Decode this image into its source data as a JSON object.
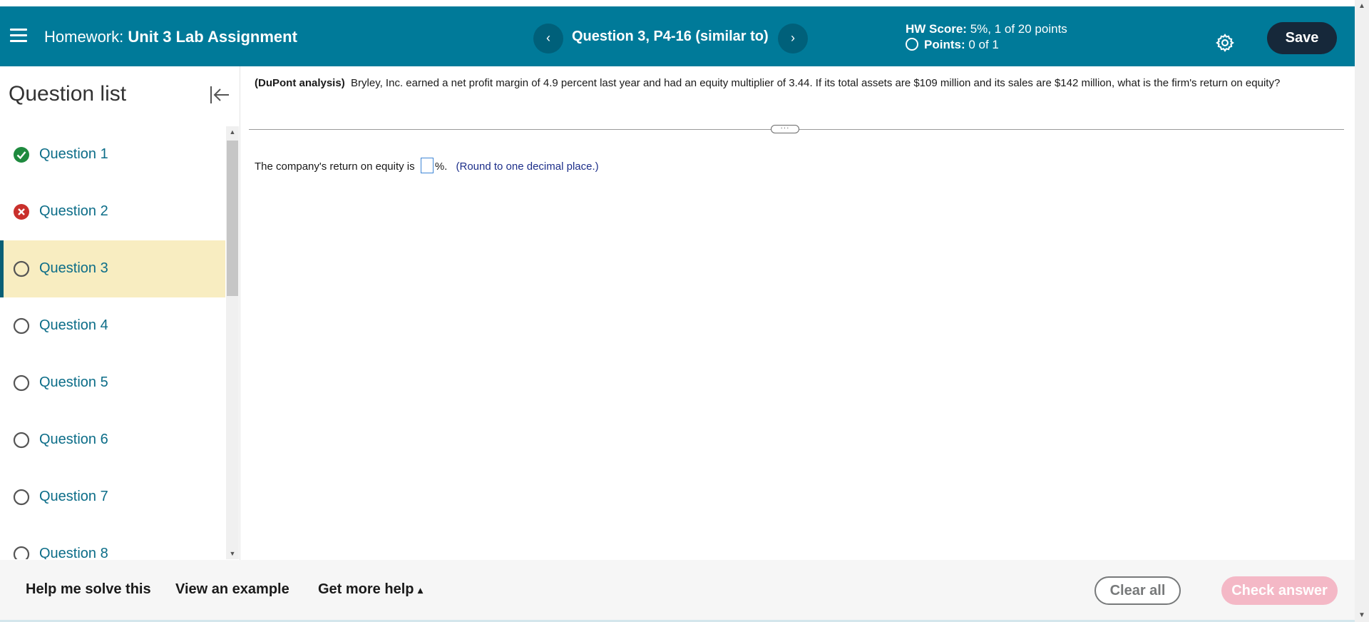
{
  "header": {
    "prefix": "Homework:",
    "assignment": "Unit 3 Lab Assignment",
    "question_title": "Question 3, P4-16 (similar to)",
    "hw_score_label": "HW Score:",
    "hw_score_value": "5%, 1 of 20 points",
    "points_label": "Points:",
    "points_value": "0 of 1",
    "save_label": "Save",
    "prev_glyph": "‹",
    "next_glyph": "›"
  },
  "sidebar": {
    "title": "Question list",
    "items": [
      {
        "label": "Question 1",
        "status": "correct"
      },
      {
        "label": "Question 2",
        "status": "incorrect"
      },
      {
        "label": "Question 3",
        "status": "current"
      },
      {
        "label": "Question 4",
        "status": "unanswered"
      },
      {
        "label": "Question 5",
        "status": "unanswered"
      },
      {
        "label": "Question 6",
        "status": "unanswered"
      },
      {
        "label": "Question 7",
        "status": "unanswered"
      },
      {
        "label": "Question 8",
        "status": "unanswered"
      }
    ]
  },
  "question": {
    "topic": "(DuPont analysis)",
    "text": "Bryley, Inc. earned a net profit margin of 4.9 percent last year and had an equity multiplier of 3.44.  If its total assets are $109 million and its sales are $142 million, what is the firm's return on equity?",
    "answer_prefix": "The company's return on equity is",
    "answer_value": "",
    "answer_suffix": "%.",
    "round_note": "(Round to one decimal place.)"
  },
  "footer": {
    "help_solve": "Help me solve this",
    "view_example": "View an example",
    "more_help": "Get more help",
    "more_help_caret": "▴",
    "clear_all": "Clear all",
    "check_answer": "Check answer"
  },
  "colors": {
    "header_bg": "#007a99",
    "correct": "#1e8a3e",
    "incorrect": "#c9302c",
    "current_bg": "#f8edc1",
    "check_answer_bg": "#f4b8c6"
  }
}
